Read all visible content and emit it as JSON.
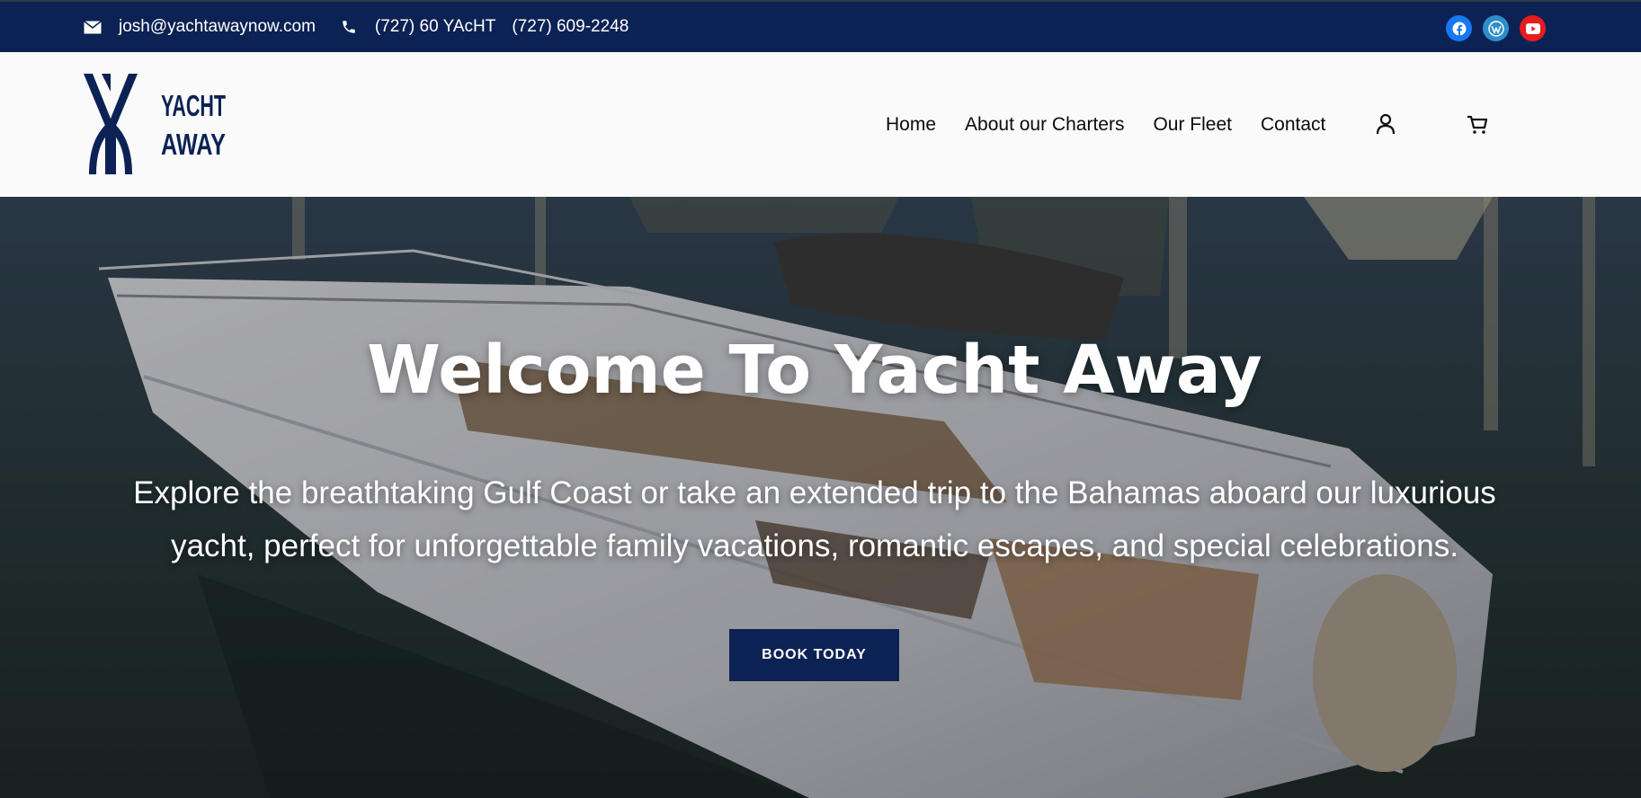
{
  "topbar": {
    "email": "josh@yachtawaynow.com",
    "phone_primary": "(727) 60 YAcHT",
    "phone_secondary": "(727) 609-2248",
    "email_icon": "envelope-icon",
    "phone_icon": "phone-icon",
    "social": [
      {
        "name": "facebook-icon",
        "color": "#1877f2"
      },
      {
        "name": "wordpress-icon",
        "color": "#2f8ec8"
      },
      {
        "name": "youtube-icon",
        "color": "#e81c1c"
      }
    ],
    "background": "#0d2254"
  },
  "header": {
    "logo_text_line1": "YACHT",
    "logo_text_line2": "AWAY",
    "nav": [
      "Home",
      "About our Charters",
      "Our Fleet",
      "Contact"
    ],
    "account_icon": "user-icon",
    "cart_icon": "cart-icon"
  },
  "hero": {
    "title": "Welcome To Yacht Away",
    "subtitle": "Explore the breathtaking Gulf Coast or take an extended trip to the Bahamas aboard our luxurious yacht, perfect for unforgettable family vacations, romantic escapes, and special celebrations.",
    "cta_label": "BOOK TODAY",
    "cta_color": "#0d2254"
  }
}
